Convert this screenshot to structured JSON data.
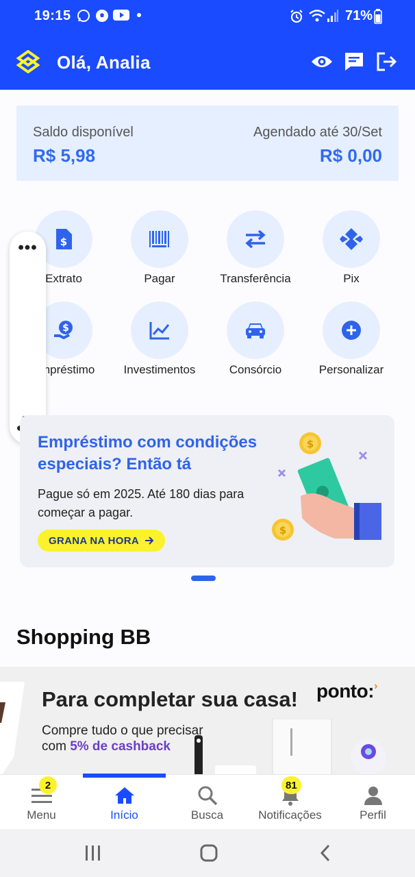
{
  "status_bar": {
    "time": "19:15",
    "battery": "71%",
    "icons": [
      "whatsapp-icon",
      "soccer-ball-icon",
      "youtube-icon",
      "dot-icon",
      "alarm-icon",
      "wifi-icon",
      "signal-icon",
      "battery-icon"
    ]
  },
  "header": {
    "greeting": "Olá, Analia",
    "icons": [
      "bb-logo-icon",
      "eye-icon",
      "message-icon",
      "logout-icon"
    ],
    "bg_color": "#1a4bff"
  },
  "balance": {
    "available_label": "Saldo disponível",
    "available_value": "R$ 5,98",
    "scheduled_label": "Agendado até 30/Set",
    "scheduled_value": "R$ 0,00",
    "value_color": "#2f6bf0"
  },
  "quick_actions": [
    {
      "label": "Extrato",
      "icon": "statement-icon"
    },
    {
      "label": "Pagar",
      "icon": "barcode-icon"
    },
    {
      "label": "Transferência",
      "icon": "transfer-icon"
    },
    {
      "label": "Pix",
      "icon": "pix-icon"
    },
    {
      "label": "Empréstimo",
      "icon": "loan-icon"
    },
    {
      "label": "Investimentos",
      "icon": "chart-icon"
    },
    {
      "label": "Consórcio",
      "icon": "car-icon"
    },
    {
      "label": "Personalizar",
      "icon": "plus-icon"
    }
  ],
  "floating_widget": {
    "menu_glyph": "•••",
    "icons": [
      "more-icon",
      "audio-icon"
    ]
  },
  "promo_banner": {
    "title": "Empréstimo com condições especiais? Então tá",
    "description": "Pague só em 2025. Até 180 dias para começar a pagar.",
    "cta": "GRANA NA HORA",
    "cta_color": "#fbf22c",
    "title_color": "#2f63ea"
  },
  "shopping": {
    "section_title": "Shopping BB",
    "banner_title": "Para completar sua casa!",
    "banner_desc_1": "Compre tudo o que precisar",
    "banner_desc_2": "com",
    "banner_cashback": "5% de cashback",
    "brand": "ponto"
  },
  "bottom_nav": {
    "tabs": [
      {
        "label": "Menu",
        "icon": "menu-icon",
        "badge": "2"
      },
      {
        "label": "Início",
        "icon": "home-icon",
        "active": true
      },
      {
        "label": "Busca",
        "icon": "search-icon"
      },
      {
        "label": "Notificações",
        "icon": "bell-icon",
        "badge": "81"
      },
      {
        "label": "Perfil",
        "icon": "profile-icon"
      }
    ]
  },
  "system_nav": {
    "icons": [
      "recents-icon",
      "home-button-icon",
      "back-icon"
    ]
  }
}
